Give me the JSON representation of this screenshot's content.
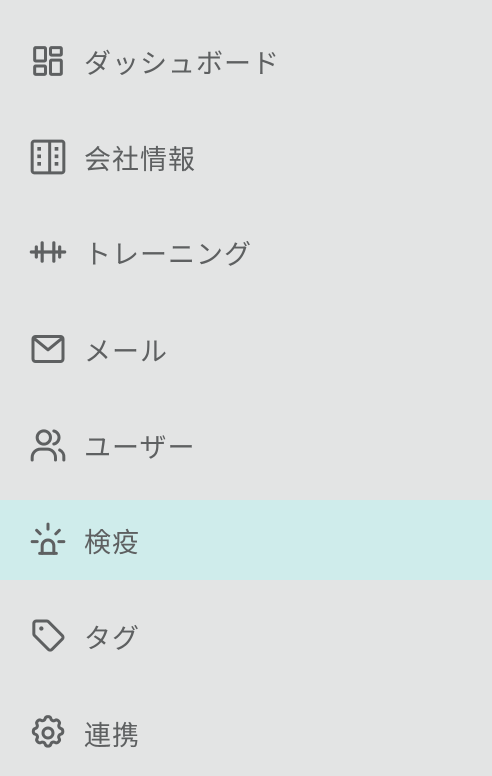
{
  "sidebar": {
    "items": [
      {
        "label": "ダッシュボード",
        "icon": "dashboard-icon",
        "active": false
      },
      {
        "label": "会社情報",
        "icon": "building-icon",
        "active": false
      },
      {
        "label": "トレーニング",
        "icon": "dumbbell-icon",
        "active": false
      },
      {
        "label": "メール",
        "icon": "mail-icon",
        "active": false
      },
      {
        "label": "ユーザー",
        "icon": "users-icon",
        "active": false
      },
      {
        "label": "検疫",
        "icon": "siren-icon",
        "active": true
      },
      {
        "label": "タグ",
        "icon": "tag-icon",
        "active": false
      },
      {
        "label": "連携",
        "icon": "gear-icon",
        "active": false
      }
    ]
  },
  "colors": {
    "background": "#e3e4e4",
    "active_background": "#cfeceb",
    "text": "#5e6061",
    "icon": "#5e6061"
  }
}
